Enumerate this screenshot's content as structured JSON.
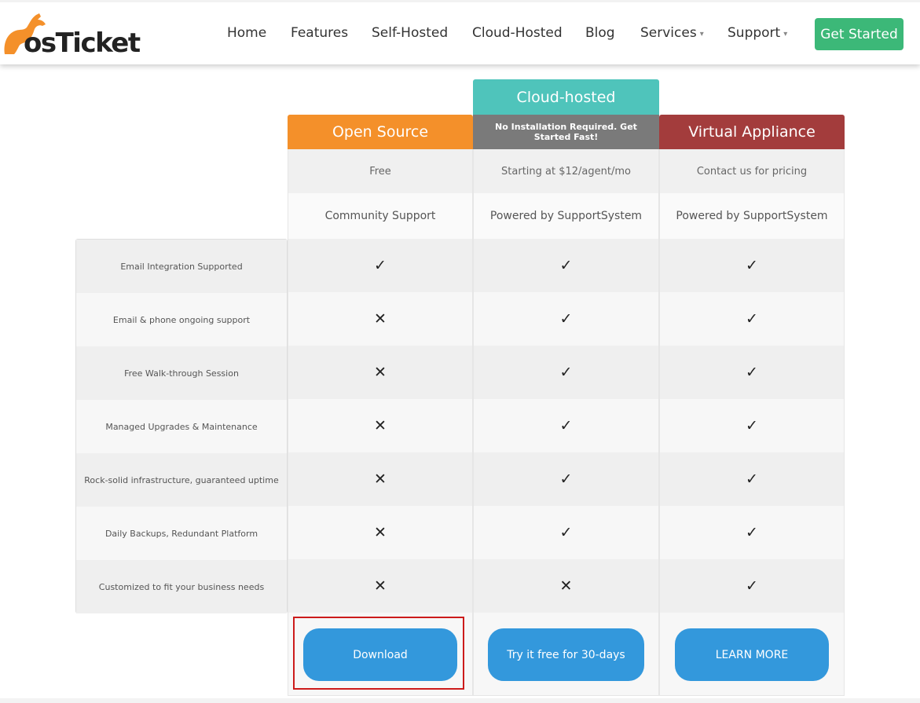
{
  "header": {
    "logo_text": "osTicket",
    "nav": [
      {
        "label": "Home"
      },
      {
        "label": "Features"
      },
      {
        "label": "Self-Hosted"
      },
      {
        "label": "Cloud-Hosted"
      },
      {
        "label": "Blog"
      },
      {
        "label": "Services",
        "dropdown": true
      },
      {
        "label": "Support",
        "dropdown": true
      }
    ],
    "cta_label": "Get Started",
    "cta_color": "#3cb878"
  },
  "plans": [
    {
      "title": "Open Source",
      "color": "#f4902a",
      "price": "Free",
      "support": "Community Support",
      "button": "Download"
    },
    {
      "title": "Cloud-hosted",
      "color": "#4fc4bb",
      "subtitle": "No Installation Required. Get Started Fast!",
      "subtitle_color": "#7a7a7a",
      "price": "Starting at $12/agent/mo",
      "support": "Powered by SupportSystem",
      "button": "Try it free for 30-days"
    },
    {
      "title": "Virtual Appliance",
      "color": "#a33c3c",
      "price": "Contact us for pricing",
      "support": "Powered by SupportSystem",
      "button": "LEARN MORE"
    }
  ],
  "features": [
    {
      "label": "Email Integration Supported",
      "marks": [
        "check",
        "check",
        "check"
      ]
    },
    {
      "label": "Email & phone ongoing support",
      "marks": [
        "cross",
        "check",
        "check"
      ]
    },
    {
      "label": "Free Walk-through Session",
      "marks": [
        "cross",
        "check",
        "check"
      ]
    },
    {
      "label": "Managed Upgrades & Maintenance",
      "marks": [
        "cross",
        "check",
        "check"
      ]
    },
    {
      "label": "Rock-solid infrastructure, guaranteed uptime",
      "marks": [
        "cross",
        "check",
        "check"
      ]
    },
    {
      "label": "Daily Backups, Redundant Platform",
      "marks": [
        "cross",
        "check",
        "check"
      ]
    },
    {
      "label": "Customized to fit your business needs",
      "marks": [
        "cross",
        "cross",
        "check"
      ]
    }
  ],
  "glyphs": {
    "check": "✓",
    "cross": "✕"
  },
  "colors": {
    "button": "#3398dc",
    "highlight": "#cc1b1b"
  }
}
